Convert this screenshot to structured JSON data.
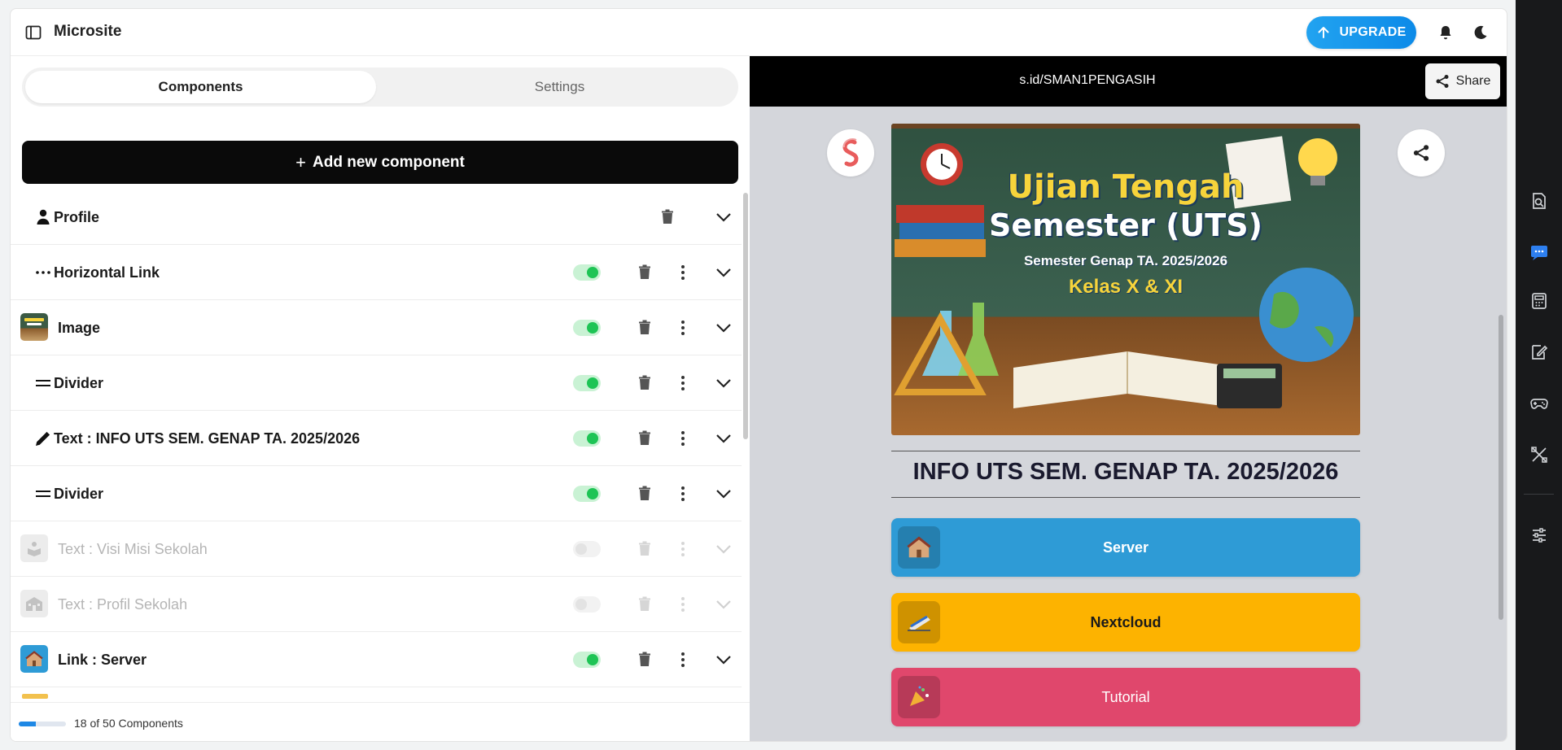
{
  "app": {
    "title": "Microsite"
  },
  "header": {
    "upgrade_label": "UPGRADE"
  },
  "tabs": [
    {
      "label": "Components",
      "active": true
    },
    {
      "label": "Settings",
      "active": false
    }
  ],
  "add_button": {
    "label": "Add new component"
  },
  "components": [
    {
      "label": "Profile",
      "icon": "person-icon",
      "toggle": null,
      "enabled": true
    },
    {
      "label": "Horizontal Link",
      "icon": "dots-horizontal-icon",
      "toggle": true,
      "enabled": true
    },
    {
      "label": "Image",
      "icon": "image-thumbnail",
      "toggle": true,
      "enabled": true
    },
    {
      "label": "Divider",
      "icon": "equals-icon",
      "toggle": true,
      "enabled": true
    },
    {
      "label": "Text : INFO UTS SEM. GENAP TA. 2025/2026",
      "icon": "pencil-icon",
      "toggle": true,
      "enabled": true
    },
    {
      "label": "Divider",
      "icon": "equals-icon",
      "toggle": true,
      "enabled": true
    },
    {
      "label": "Text : Visi Misi Sekolah",
      "icon": "book-reader-icon",
      "toggle": false,
      "enabled": false
    },
    {
      "label": "Text : Profil Sekolah",
      "icon": "school-icon",
      "toggle": false,
      "enabled": false
    },
    {
      "label": "Link : Server",
      "icon": "house-icon",
      "toggle": true,
      "enabled": true
    }
  ],
  "footer": {
    "count_text": "18 of 50 Components",
    "progress": 0.36
  },
  "preview": {
    "url": "s.id/SMAN1PENGASIH",
    "share_label": "Share",
    "banner": {
      "line1": "Ujian Tengah",
      "line2": "Semester (UTS)",
      "line3": "Semester Genap TA. 2025/2026",
      "line4": "Kelas X & XI"
    },
    "info_title": "INFO UTS SEM. GENAP TA. 2025/2026",
    "links": [
      {
        "label": "Server",
        "color": "#2e9bd6",
        "text_color": "#ffffff",
        "icon": "house-icon"
      },
      {
        "label": "Nextcloud",
        "color": "#fdb300",
        "text_color": "#1a1a1a",
        "icon": "train-icon"
      },
      {
        "label": "Tutorial",
        "color": "#e0476c",
        "text_color": "#ffffff",
        "icon": "party-icon"
      }
    ]
  },
  "colors": {
    "accent": "#0c8ae8",
    "toggle_on": "#1ec455",
    "preview_bg": "#d4d6db"
  }
}
